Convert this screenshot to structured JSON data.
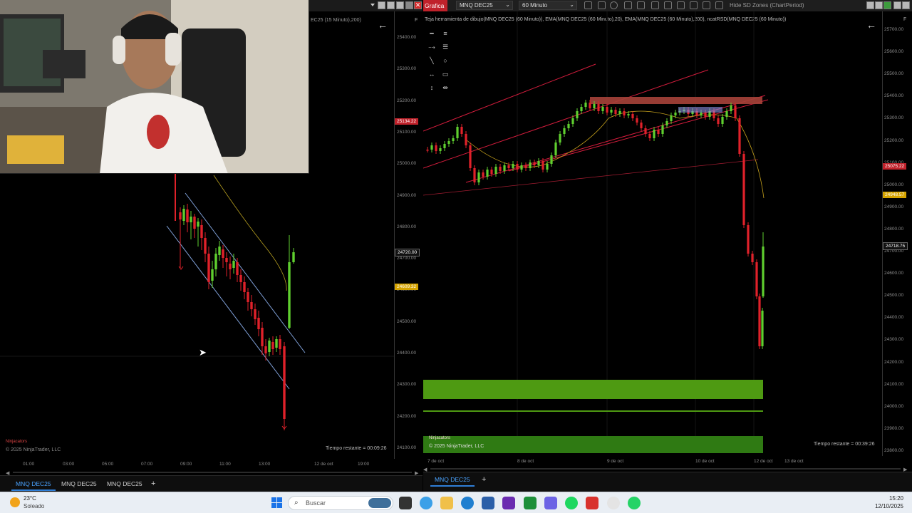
{
  "left_chart": {
    "title": "EC25 (15 Minuto),200)",
    "price_ticks": [
      "25400.00",
      "25300.00",
      "25200.00",
      "25100.00",
      "25000.00",
      "24900.00",
      "24800.00",
      "24700.00",
      "24600.00",
      "24500.00",
      "24400.00",
      "24300.00",
      "24200.00",
      "24100.00"
    ],
    "price_tags": [
      {
        "label": "25134.22",
        "color": "#c0222b"
      },
      {
        "label": "24720.00",
        "color": "#111111"
      },
      {
        "label": "24609.32",
        "color": "#d6a400"
      }
    ],
    "time_ticks": [
      "01:00",
      "03:00",
      "05:00",
      "07:00",
      "09:00",
      "11:00",
      "13:00",
      "12 de oct",
      "19:00"
    ],
    "copyright": "© 2025 NinjaTrader, LLC",
    "brand": "Ninjacators",
    "remaining": "Tiempo restante = 00:09:26",
    "axis_letter": "F",
    "tabs": [
      "MNQ DEC25",
      "MNQ DEC25",
      "MNQ DEC25"
    ],
    "add_tab": "+"
  },
  "right_chart": {
    "toolbar": {
      "title": "Grafica",
      "instrument": "MNQ DEC25",
      "interval": "60 Minuto",
      "hide_sd": "Hide SD Zones (ChartPeriod)"
    },
    "title": "Teja herramienta de dibujo(MNQ DEC25 (60 Minuto)), EMA(MNQ DEC25 (60 Minuto),20), EMA(MNQ DEC25 (60 Minuto),200), ncatRSD(MNQ DEC25 (60 Minuto))",
    "price_ticks": [
      "25700.00",
      "25600.00",
      "25500.00",
      "25400.00",
      "25300.00",
      "25200.00",
      "25100.00",
      "25000.00",
      "24900.00",
      "24800.00",
      "24700.00",
      "24600.00",
      "24500.00",
      "24400.00",
      "24300.00",
      "24200.00",
      "24100.00",
      "24000.00",
      "23900.00",
      "23800.00"
    ],
    "price_tags": [
      {
        "label": "25075.22",
        "color": "#c0222b"
      },
      {
        "label": "24948.57",
        "color": "#d6a400"
      },
      {
        "label": "24718.75",
        "color": "#111111"
      }
    ],
    "time_ticks": [
      "7 de oct",
      "8 de oct",
      "9 de oct",
      "10 de oct",
      "12 de oct",
      "13 de oct"
    ],
    "copyright": "© 2025 NinjaTrader, LLC",
    "brand": "Ninjacators",
    "remaining": "Tiempo restante = 00:39:26",
    "axis_letter": "F",
    "tabs": [
      "MNQ DEC25"
    ],
    "add_tab": "+"
  },
  "taskbar": {
    "weather_temp": "23°C",
    "weather_desc": "Soleado",
    "search_placeholder": "Buscar",
    "time": "15:20",
    "date": "12/10/2025"
  },
  "colors": {
    "bull": "#5fcf2f",
    "bear": "#e0212a",
    "channel": "#d21c3c",
    "zone_green": "#4e9a12",
    "zone_red": "#a7433a",
    "accent": "#2f7fd8"
  }
}
